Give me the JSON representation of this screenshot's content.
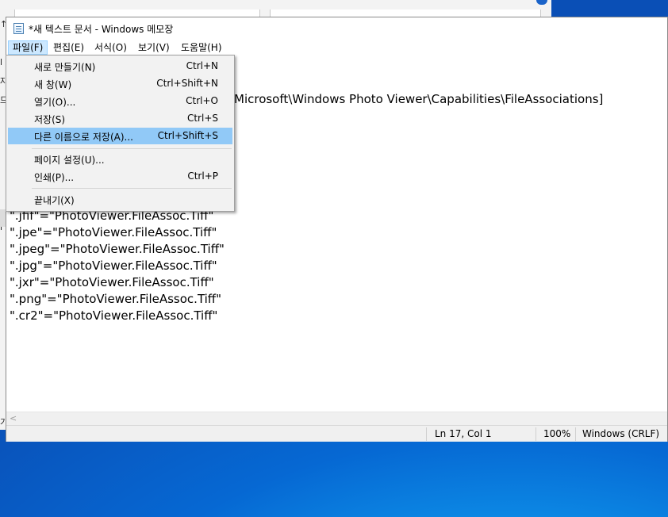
{
  "window": {
    "title": "*새 텍스트 문서 - Windows 메모장"
  },
  "menubar": [
    {
      "label": "파일(F)",
      "active": true
    },
    {
      "label": "편집(E)"
    },
    {
      "label": "서식(O)"
    },
    {
      "label": "보기(V)"
    },
    {
      "label": "도움말(H)"
    }
  ],
  "file_menu": {
    "items": [
      {
        "label": "새로 만들기(N)",
        "shortcut": "Ctrl+N"
      },
      {
        "label": "새 창(W)",
        "shortcut": "Ctrl+Shift+N"
      },
      {
        "label": "열기(O)...",
        "shortcut": "Ctrl+O"
      },
      {
        "label": "저장(S)",
        "shortcut": "Ctrl+S"
      },
      {
        "label": "다른 이름으로 저장(A)...",
        "shortcut": "Ctrl+Shift+S",
        "highlighted": true
      },
      {
        "label": "페이지 설정(U)..."
      },
      {
        "label": "인쇄(P)...",
        "shortcut": "Ctrl+P"
      },
      {
        "label": "끝내기(X)"
      }
    ]
  },
  "editor": {
    "partial_line": "Microsoft\\Windows Photo Viewer\\Capabilities\\FileAssociations]",
    "lines": [
      "\".jfif\"=\"PhotoViewer.FileAssoc.Tiff\"",
      "\".jpe\"=\"PhotoViewer.FileAssoc.Tiff\"",
      "\".jpeg\"=\"PhotoViewer.FileAssoc.Tiff\"",
      "\".jpg\"=\"PhotoViewer.FileAssoc.Tiff\"",
      "\".jxr\"=\"PhotoViewer.FileAssoc.Tiff\"",
      "\".png\"=\"PhotoViewer.FileAssoc.Tiff\"",
      "\".cr2\"=\"PhotoViewer.FileAssoc.Tiff\""
    ]
  },
  "statusbar": {
    "position": "Ln 17, Col 1",
    "zoom": "100%",
    "encoding": "Windows (CRLF)"
  },
  "background_left_chars": [
    "↑",
    "l",
    "자",
    "므",
    "l",
    "가"
  ],
  "colors": {
    "menu_highlight": "#91c9f7",
    "menubar_active": "#cce8ff",
    "desktop": "#0a6ad6"
  },
  "icons": {
    "window": "notepad-icon",
    "scroll_left": "chevron-left-icon"
  }
}
